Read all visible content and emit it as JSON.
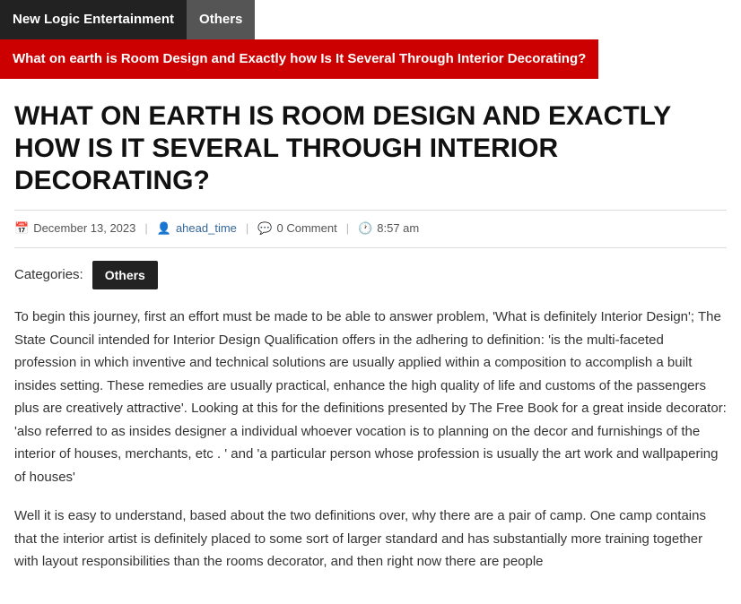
{
  "breadcrumb": {
    "items": [
      {
        "label": "New Logic Entertainment",
        "style": "dark-bg"
      },
      {
        "label": "Others",
        "style": "mid-bg"
      },
      {
        "label": "What on earth is Room Design and Exactly how Is It Several Through Interior Decorating?",
        "style": "red-bg"
      }
    ]
  },
  "post": {
    "title": "WHAT ON EARTH IS ROOM DESIGN AND EXACTLY HOW IS IT SEVERAL THROUGH INTERIOR DECORATING?",
    "meta": {
      "date": "December 13, 2023",
      "author": "ahead_time",
      "comments": "0 Comment",
      "time": "8:57 am"
    },
    "categories_label": "Categories:",
    "category": "Others",
    "body_paragraph_1": "To begin this journey, first an effort must be made to be able to answer problem, 'What is definitely Interior Design'; The State Council intended for Interior Design Qualification offers in the adhering to definition: 'is the multi-faceted profession in which inventive and technical solutions are usually applied within a composition to accomplish a built insides setting. These remedies are usually practical, enhance the high quality of life and customs of the passengers plus are creatively attractive'. Looking at this for the definitions presented by The Free Book for a great inside decorator: 'also referred to as insides designer a individual whoever vocation is to planning on the decor and furnishings of the interior of houses, merchants, etc . ' and 'a particular person whose profession is usually the art work and wallpapering of houses'",
    "body_paragraph_2": "Well it is easy to understand, based about the two definitions over, why there are a pair of camp. One camp contains that the interior artist is definitely placed to some sort of larger standard and has substantially more training together with layout responsibilities than the rooms decorator, and then right now there are people"
  }
}
